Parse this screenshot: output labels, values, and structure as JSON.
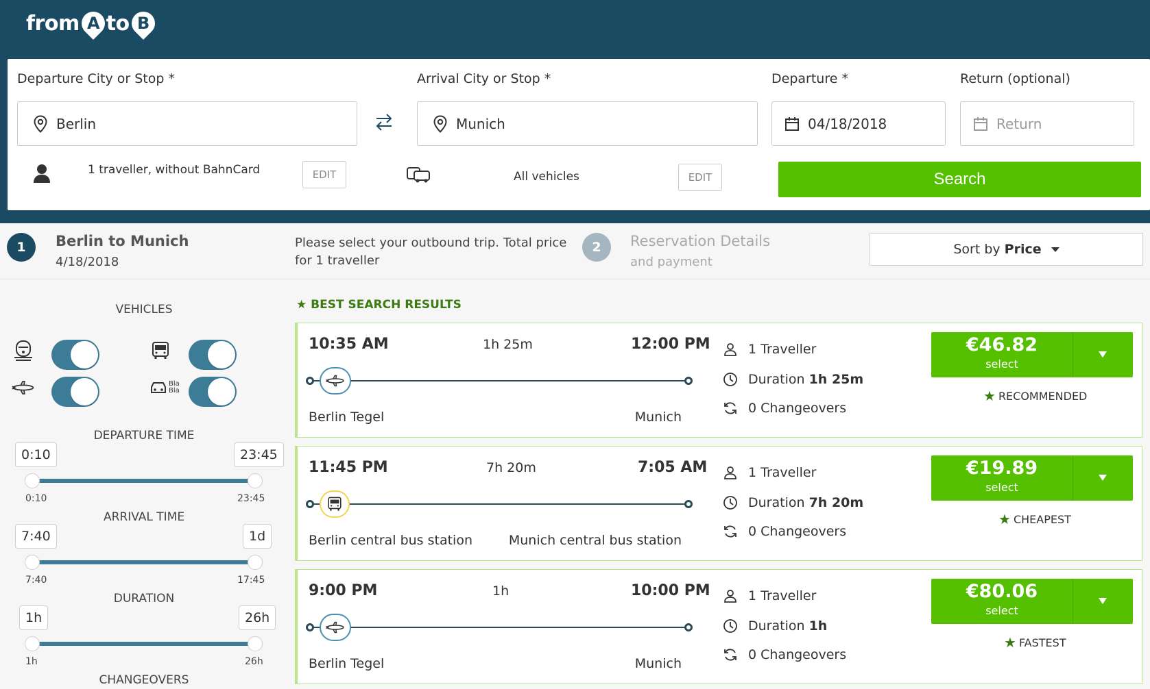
{
  "brand": {
    "logo_from": "from",
    "logo_a": "A",
    "logo_to": "to",
    "logo_b": "B"
  },
  "search": {
    "departure_label": "Departure City or Stop *",
    "departure_value": "Berlin",
    "arrival_label": "Arrival City or Stop *",
    "arrival_value": "Munich",
    "date_label": "Departure *",
    "date_value": "04/18/2018",
    "return_label": "Return (optional)",
    "return_placeholder": "Return",
    "travellers_text": "1 traveller, without BahnCard",
    "travellers_edit": "EDIT",
    "vehicles_text": "All vehicles",
    "vehicles_edit": "EDIT",
    "search_button": "Search"
  },
  "steps": {
    "step1_number": "1",
    "step1_title": "Berlin to Munich",
    "step1_date": "4/18/2018",
    "instruction_line1": "Please select your outbound trip. Total price",
    "instruction_line2": "for 1 traveller",
    "step2_number": "2",
    "step2_title": "Reservation Details",
    "step2_sub": "and payment",
    "sort_prefix": "Sort by",
    "sort_value": "Price"
  },
  "filters": {
    "vehicles_heading": "VEHICLES",
    "vehicle_toggles": [
      {
        "icon": "train-icon",
        "enabled": true
      },
      {
        "icon": "bus-icon",
        "enabled": true
      },
      {
        "icon": "plane-icon",
        "enabled": true
      },
      {
        "icon": "blablacar-icon",
        "enabled": true
      }
    ],
    "blabla_label": "Bla Bla",
    "departure_heading": "DEPARTURE TIME",
    "departure_min_pill": "0:10",
    "departure_max_pill": "23:45",
    "departure_min_label": "0:10",
    "departure_max_label": "23:45",
    "arrival_heading": "ARRIVAL TIME",
    "arrival_min_pill": "7:40",
    "arrival_max_pill": "1d",
    "arrival_min_label": "7:40",
    "arrival_max_label": "17:45",
    "duration_heading": "DURATION",
    "duration_min_pill": "1h",
    "duration_max_pill": "26h",
    "duration_min_label": "1h",
    "duration_max_label": "26h",
    "changeovers_heading": "CHANGEOVERS"
  },
  "results": {
    "heading": "BEST SEARCH RESULTS",
    "trips": [
      {
        "depart": "10:35 AM",
        "duration": "1h 25m",
        "arrive": "12:00 PM",
        "vehicle": "plane-icon",
        "from": "Berlin Tegel",
        "to": "Munich",
        "travellers": "1 Traveller",
        "duration_prefix": "Duration",
        "duration_value": "1h 25m",
        "changeovers": "0 Changeovers",
        "price": "€46.82",
        "select": "select",
        "tag": "RECOMMENDED"
      },
      {
        "depart": "11:45 PM",
        "duration": "7h 20m",
        "arrive": "7:05 AM",
        "vehicle": "bus-icon",
        "from": "Berlin central bus station",
        "to": "Munich central bus station",
        "travellers": "1 Traveller",
        "duration_prefix": "Duration",
        "duration_value": "7h 20m",
        "changeovers": "0 Changeovers",
        "price": "€19.89",
        "select": "select",
        "tag": "CHEAPEST"
      },
      {
        "depart": "9:00 PM",
        "duration": "1h",
        "arrive": "10:00 PM",
        "vehicle": "plane-icon",
        "from": "Berlin Tegel",
        "to": "Munich",
        "travellers": "1 Traveller",
        "duration_prefix": "Duration",
        "duration_value": "1h",
        "changeovers": "0 Changeovers",
        "price": "€80.06",
        "select": "select",
        "tag": "FASTEST"
      }
    ]
  },
  "colors": {
    "header": "#1b4a63",
    "accent_green": "#55c000",
    "toggle_blue": "#3d7c97",
    "card_border": "#b9e58c",
    "tag_star": "#3c7a12"
  }
}
